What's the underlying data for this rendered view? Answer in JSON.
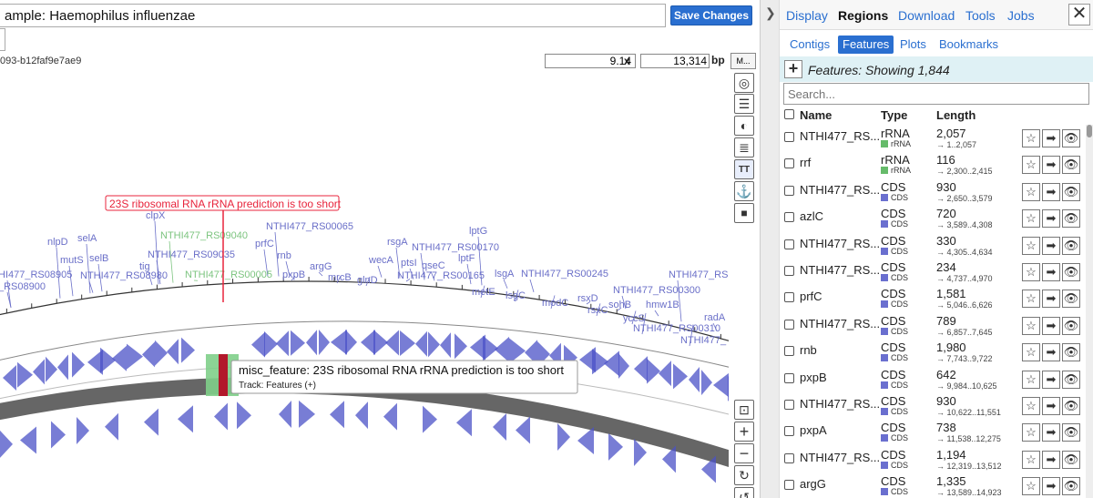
{
  "map": {
    "title_value": "ample: Haemophilus influenzae",
    "save_label": "Save Changes",
    "map_id": "093-b12faf9e7ae9",
    "zoom_value": "9.14",
    "zoom_unit": "x",
    "length_value": "13,314",
    "length_unit": "bp",
    "more_label": "M...",
    "tooltip_title": "misc_feature: 23S ribosomal RNA rRNA prediction is too short",
    "tooltip_track": "Track: Features (+)",
    "highlight_label": "23S ribosomal RNA rRNA prediction is too short",
    "labels": [
      {
        "text": "clpX",
        "c": "b"
      },
      {
        "text": "NTHI477_RS09040",
        "c": "g"
      },
      {
        "text": "NTHI477_RS00065",
        "c": "b"
      },
      {
        "text": "nlpD",
        "c": "b"
      },
      {
        "text": "selA",
        "c": "b"
      },
      {
        "text": "prfC",
        "c": "b"
      },
      {
        "text": "mutS",
        "c": "b"
      },
      {
        "text": "selB",
        "c": "b"
      },
      {
        "text": "NTHI477_RS09035",
        "c": "b"
      },
      {
        "text": "rnb",
        "c": "b"
      },
      {
        "text": "tig",
        "c": "b"
      },
      {
        "text": "argG",
        "c": "b"
      },
      {
        "text": "HI477_RS08905",
        "c": "b"
      },
      {
        "text": "NTHI477_RS08980",
        "c": "b"
      },
      {
        "text": "NTHI477_RS00005",
        "c": "g"
      },
      {
        "text": "pxpB",
        "c": "b"
      },
      {
        "text": "mrcB",
        "c": "b"
      },
      {
        "text": "_RS08900",
        "c": "b"
      },
      {
        "text": "rsgA",
        "c": "b"
      },
      {
        "text": "lptG",
        "c": "b"
      },
      {
        "text": "NTHI477_RS00170",
        "c": "b"
      },
      {
        "text": "wecA",
        "c": "b"
      },
      {
        "text": "ptsI",
        "c": "b"
      },
      {
        "text": "lptF",
        "c": "b"
      },
      {
        "text": "qseC",
        "c": "b"
      },
      {
        "text": "glnD",
        "c": "b"
      },
      {
        "text": "NTHI477_RS00165",
        "c": "b"
      },
      {
        "text": "lsgA",
        "c": "b"
      },
      {
        "text": "NTHI477_RS00245",
        "c": "b"
      },
      {
        "text": "NTHI477_RS",
        "c": "b"
      },
      {
        "text": "metE",
        "c": "b"
      },
      {
        "text": "lsgC",
        "c": "b"
      },
      {
        "text": "NTHI477_RS00300",
        "c": "b"
      },
      {
        "text": "rsxD",
        "c": "b"
      },
      {
        "text": "modC",
        "c": "b"
      },
      {
        "text": "sohB",
        "c": "b"
      },
      {
        "text": "hmw1B",
        "c": "b"
      },
      {
        "text": "rsxC",
        "c": "b"
      },
      {
        "text": "radA",
        "c": "b"
      },
      {
        "text": "yccS",
        "c": "b"
      },
      {
        "text": "NTHI477_RS00310",
        "c": "b"
      },
      {
        "text": "NTHI477_",
        "c": "b"
      }
    ]
  },
  "toolbar": {
    "icons": [
      "ring-icon",
      "linear-icon",
      "contrast-icon",
      "legend-icon",
      "labels-icon",
      "anchor-icon",
      "lock-icon"
    ],
    "bottom_icons": [
      "fit-icon",
      "zoom-in-icon",
      "zoom-out-icon",
      "rotate-icon",
      "rotate-back-icon"
    ]
  },
  "panel": {
    "splitter_icon": "chevron-right-icon",
    "tabs": [
      "Display",
      "Regions",
      "Download",
      "Tools",
      "Jobs"
    ],
    "active_tab": "Regions",
    "close_icon": "close-icon",
    "subtabs": [
      "Contigs",
      "Features",
      "Plots",
      "Bookmarks"
    ],
    "active_subtab": "Features",
    "features_count": "Features: Showing 1,844",
    "search_placeholder": "Search...",
    "columns": {
      "name": "Name",
      "type": "Type",
      "length": "Length"
    },
    "colors": {
      "rRNA": "#66bb6a",
      "CDS": "#6a6fcf",
      "accent": "#2a6fd0"
    },
    "rows": [
      {
        "name": "NTHI477_RS...",
        "type": "rRNA",
        "sub": "rRNA",
        "length": "2,057",
        "range": "→ 1..2,057"
      },
      {
        "name": "rrf",
        "type": "rRNA",
        "sub": "rRNA",
        "length": "116",
        "range": "→ 2,300..2,415"
      },
      {
        "name": "NTHI477_RS...",
        "type": "CDS",
        "sub": "CDS",
        "length": "930",
        "range": "→ 2,650..3,579"
      },
      {
        "name": "azlC",
        "type": "CDS",
        "sub": "CDS",
        "length": "720",
        "range": "→ 3,589..4,308"
      },
      {
        "name": "NTHI477_RS...",
        "type": "CDS",
        "sub": "CDS",
        "length": "330",
        "range": "→ 4,305..4,634"
      },
      {
        "name": "NTHI477_RS...",
        "type": "CDS",
        "sub": "CDS",
        "length": "234",
        "range": "→ 4,737..4,970"
      },
      {
        "name": "prfC",
        "type": "CDS",
        "sub": "CDS",
        "length": "1,581",
        "range": "→ 5,046..6,626"
      },
      {
        "name": "NTHI477_RS...",
        "type": "CDS",
        "sub": "CDS",
        "length": "789",
        "range": "→ 6,857..7,645"
      },
      {
        "name": "rnb",
        "type": "CDS",
        "sub": "CDS",
        "length": "1,980",
        "range": "→ 7,743..9,722"
      },
      {
        "name": "pxpB",
        "type": "CDS",
        "sub": "CDS",
        "length": "642",
        "range": "→ 9,984..10,625"
      },
      {
        "name": "NTHI477_RS...",
        "type": "CDS",
        "sub": "CDS",
        "length": "930",
        "range": "→ 10,622..11,551"
      },
      {
        "name": "pxpA",
        "type": "CDS",
        "sub": "CDS",
        "length": "738",
        "range": "→ 11,538..12,275"
      },
      {
        "name": "NTHI477_RS...",
        "type": "CDS",
        "sub": "CDS",
        "length": "1,194",
        "range": "→ 12,319..13,512"
      },
      {
        "name": "argG",
        "type": "CDS",
        "sub": "CDS",
        "length": "1,335",
        "range": "→ 13,589..14,923"
      }
    ]
  }
}
